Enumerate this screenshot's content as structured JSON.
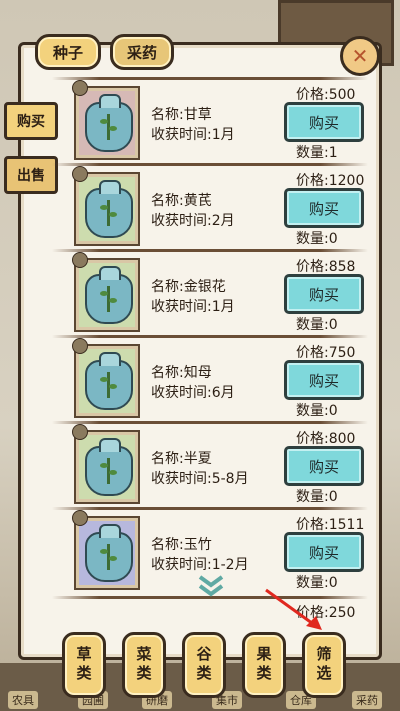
{
  "tabs": {
    "seed": "种子",
    "herb": "采药"
  },
  "side": {
    "buy": "购买",
    "sell": "出售"
  },
  "labels": {
    "name_prefix": "名称:",
    "time_prefix": "收获时间:",
    "price_prefix": "价格:",
    "qty_prefix": "数量:",
    "buy": "购买"
  },
  "items": [
    {
      "name": "名称:甘草",
      "time": "收获时间:1月",
      "price": "价格:500",
      "qty": "数量:1",
      "buy": "购买",
      "bg": "#d6b9b6"
    },
    {
      "name": "名称:黄芪",
      "time": "收获时间:2月",
      "price": "价格:1200",
      "qty": "数量:0",
      "buy": "购买",
      "bg": "#cddcae"
    },
    {
      "name": "名称:金银花",
      "time": "收获时间:1月",
      "price": "价格:858",
      "qty": "数量:0",
      "buy": "购买",
      "bg": "#cddcae"
    },
    {
      "name": "名称:知母",
      "time": "收获时间:6月",
      "price": "价格:750",
      "qty": "数量:0",
      "buy": "购买",
      "bg": "#cddcae"
    },
    {
      "name": "名称:半夏",
      "time": "收获时间:5-8月",
      "price": "价格:800",
      "qty": "数量:0",
      "buy": "购买",
      "bg": "#cddcae"
    },
    {
      "name": "名称:玉竹",
      "time": "收获时间:1-2月",
      "price": "价格:1511",
      "qty": "数量:0",
      "buy": "购买",
      "bg": "#b7b8dd"
    }
  ],
  "partial_price": "价格:250",
  "categories": [
    "草类",
    "菜类",
    "谷类",
    "果类",
    "筛选"
  ],
  "bottom_bar": [
    "农具",
    "园圃",
    "研磨",
    "集市",
    "仓库",
    "采药"
  ],
  "colors": {
    "accent": "#f3d27d",
    "buy_button": "#7fd8db",
    "arrow": "#e0281f"
  }
}
